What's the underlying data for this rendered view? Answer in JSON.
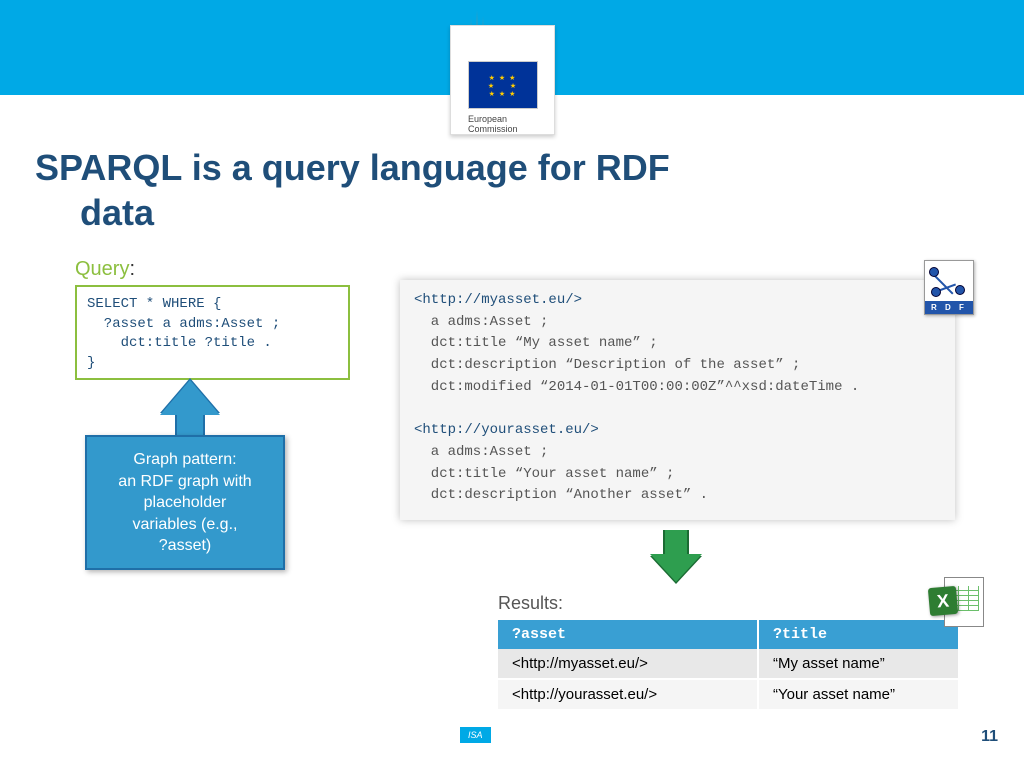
{
  "header": {
    "org_line1": "European",
    "org_line2": "Commission",
    "isa": "ISA"
  },
  "title_line1": "SPARQL is a query language for RDF",
  "title_line2": "data",
  "query_label": "Query",
  "query_code": "SELECT * WHERE {\n  ?asset a adms:Asset ;\n    dct:title ?title .\n}",
  "callout": "Graph pattern:\nan RDF graph with\nplaceholder\nvariables (e.g.,\n?asset)",
  "rdf_data": {
    "uri1": "<http://myasset.eu/>",
    "body1": "  a adms:Asset ;\n  dct:title “My asset name” ;\n  dct:description “Description of the asset” ;\n  dct:modified “2014-01-01T00:00:00Z”^^xsd:dateTime .",
    "uri2": "<http://yourasset.eu/>",
    "body2": "  a adms:Asset ;\n  dct:title “Your asset name” ;\n  dct:description “Another asset” ."
  },
  "results_label": "Results:",
  "results": {
    "headers": [
      "?asset",
      "?title"
    ],
    "rows": [
      [
        "<http://myasset.eu/>",
        "“My asset name”"
      ],
      [
        "<http://yourasset.eu/>",
        "“Your asset name”"
      ]
    ]
  },
  "icons": {
    "rdf_label": "R D F",
    "xls_label": "X"
  },
  "page_number": "11"
}
